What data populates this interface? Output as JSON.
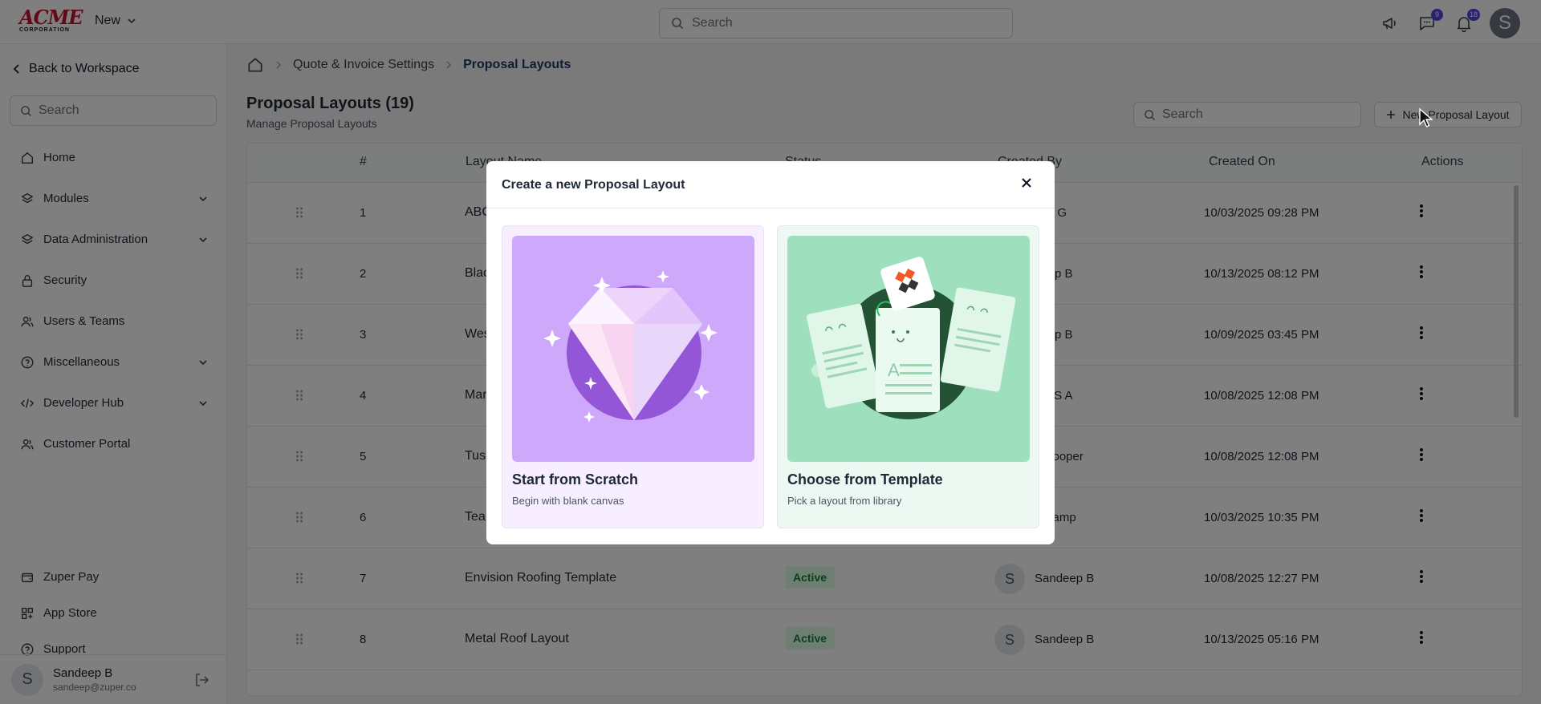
{
  "brand": {
    "logo_main": "ACME",
    "logo_sub": "CORPORATION",
    "accent": "#c8102e"
  },
  "topbar": {
    "new_label": "New",
    "search_placeholder": "Search",
    "chat_badge": "9",
    "notif_badge": "18",
    "avatar_initial": "S"
  },
  "sidebar": {
    "back_label": "Back to Workspace",
    "search_placeholder": "Search",
    "items": [
      {
        "label": "Home",
        "icon": "home-icon"
      },
      {
        "label": "Modules",
        "icon": "layers-icon"
      },
      {
        "label": "Data Administration",
        "icon": "database-icon"
      },
      {
        "label": "Security",
        "icon": "lock-icon"
      },
      {
        "label": "Users & Teams",
        "icon": "users-icon"
      },
      {
        "label": "Miscellaneous",
        "icon": "help-circle-icon"
      },
      {
        "label": "Developer Hub",
        "icon": "code-icon"
      },
      {
        "label": "Customer Portal",
        "icon": "people-icon"
      }
    ],
    "bottom_items": [
      {
        "label": "Zuper Pay",
        "icon": "wallet-icon"
      },
      {
        "label": "App Store",
        "icon": "grid-icon"
      },
      {
        "label": "Support",
        "icon": "help-icon"
      }
    ],
    "user": {
      "initial": "S",
      "name": "Sandeep B",
      "email": "sandeep@zuper.co"
    }
  },
  "breadcrumb": {
    "parent": "Quote & Invoice Settings",
    "current": "Proposal Layouts"
  },
  "page": {
    "title": "Proposal Layouts (19)",
    "subtitle": "Manage Proposal Layouts",
    "search_placeholder": "Search",
    "new_button": "New Proposal Layout"
  },
  "table": {
    "headers": {
      "num": "#",
      "name": "Layout Name",
      "status": "Status",
      "created_by": "Created By",
      "created_on": "Created On",
      "actions": "Actions"
    },
    "rows": [
      {
        "num": "1",
        "name": "ABC",
        "status": "",
        "initial": "",
        "by": "hav G",
        "on": "10/03/2025 09:28 PM"
      },
      {
        "num": "2",
        "name": "Blac",
        "status": "",
        "initial": "",
        "by": "deep B",
        "on": "10/13/2025 08:12 PM"
      },
      {
        "num": "3",
        "name": "Wes",
        "status": "",
        "initial": "",
        "by": "deep B",
        "on": "10/09/2025 03:45 PM"
      },
      {
        "num": "4",
        "name": "Mar",
        "status": "",
        "initial": "",
        "by": "lon S A",
        "on": "10/08/2025 12:08 PM"
      },
      {
        "num": "5",
        "name": "Tus",
        "status": "",
        "initial": "",
        "by": "k Cooper",
        "on": "10/08/2025 12:08 PM"
      },
      {
        "num": "6",
        "name": "Tea",
        "status": "",
        "initial": "",
        "by": "e Kamp",
        "on": "10/03/2025 10:35 PM"
      },
      {
        "num": "7",
        "name": "Envision Roofing Template",
        "status": "Active",
        "initial": "S",
        "by": "Sandeep B",
        "on": "10/08/2025 12:27 PM"
      },
      {
        "num": "8",
        "name": "Metal Roof Layout",
        "status": "Active",
        "initial": "S",
        "by": "Sandeep B",
        "on": "10/13/2025 05:16 PM"
      }
    ]
  },
  "modal": {
    "title": "Create a new Proposal Layout",
    "options": [
      {
        "title": "Start from Scratch",
        "desc": "Begin with blank canvas",
        "bg": "#f7efff",
        "illustration": "diamond-illustration"
      },
      {
        "title": "Choose from Template",
        "desc": "Pick a layout from library",
        "bg": "#ecf8f1",
        "illustration": "documents-illustration"
      }
    ]
  }
}
